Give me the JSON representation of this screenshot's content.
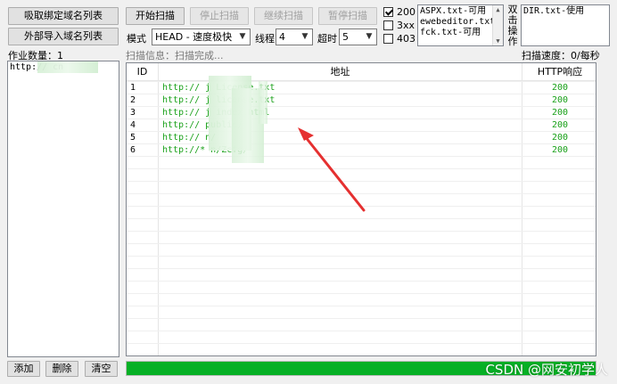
{
  "toolbar": {
    "fetch_domain_label": "吸取绑定域名列表",
    "import_domain_label": "外部导入域名列表",
    "start_label": "开始扫描",
    "stop_label": "停止扫描",
    "continue_label": "继续扫描",
    "pause_label": "暂停扫描"
  },
  "options": {
    "mode_label": "模式",
    "mode_value": "HEAD - 速度极快",
    "threads_label": "线程",
    "threads_value": "4",
    "timeout_label": "超时",
    "timeout_value": "5"
  },
  "status_filters": [
    {
      "label": "200",
      "checked": true
    },
    {
      "label": "3xx",
      "checked": false
    },
    {
      "label": "403",
      "checked": false
    }
  ],
  "dict_list": [
    "ASPX.txt-可用",
    "ewebeditor.txt-i",
    "fck.txt-可用"
  ],
  "double_click_label": "双击操作",
  "dir_list": [
    "DIR.txt-使用"
  ],
  "job_count": "作业数量：1",
  "scan_info": "扫描信息：扫描完成...",
  "scan_speed": "扫描速度：0/每秒",
  "job_list": [
    "http://                cn"
  ],
  "table": {
    "headers": [
      "ID",
      "地址",
      "HTTP响应"
    ],
    "rows": [
      {
        "id": "1",
        "url": "http://         j            License.txt",
        "code": "200"
      },
      {
        "id": "2",
        "url": "http://         j            license.txt",
        "code": "200"
      },
      {
        "id": "3",
        "url": "http://         j            index.html",
        "code": "200"
      },
      {
        "id": "4",
        "url": "http://                      public/",
        "code": "200"
      },
      {
        "id": "5",
        "url": "http://                    n/",
        "code": "200"
      },
      {
        "id": "6",
        "url": "http://*                  n/Zcfg/",
        "code": "200"
      }
    ]
  },
  "bottom_buttons": {
    "add_label": "添加",
    "delete_label": "删除",
    "clear_label": "清空"
  },
  "progress": 1.0,
  "watermark": "CSDN @网安初学人",
  "colors": {
    "url_green": "#1aa11a",
    "progress_green": "#06b025",
    "arrow_red": "#e53030"
  }
}
